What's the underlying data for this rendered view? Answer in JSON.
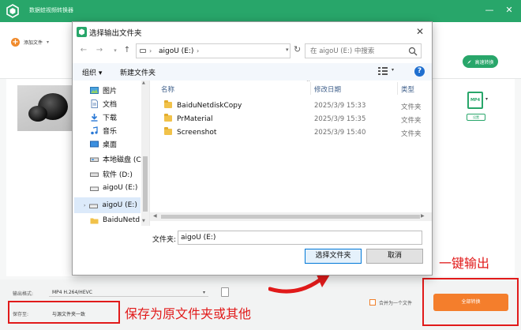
{
  "app": {
    "title": "数据蛙视频转换器",
    "add_file": "添加文件",
    "add_file_caret": "▾",
    "hw_accel": "高速转换",
    "format_badge": "MP4",
    "settings_label": "设置",
    "window_minimize": "—",
    "window_close": "✕"
  },
  "footer": {
    "output_format_label": "输出格式:",
    "output_format_value": "MP4 H.264/HEVC",
    "save_to_label": "保存至:",
    "save_to_value": "与源文件夹一致",
    "merge_label": "合并为一个文件",
    "convert_all": "全部转换"
  },
  "annotations": {
    "save_text": "保存为原文件夹或其他",
    "export_text": "一键输出",
    "color": "#e11a1a"
  },
  "dialog": {
    "title": "选择输出文件夹",
    "close": "✕",
    "address": "aigoU (E:)",
    "address_sep": "›",
    "search_placeholder": "在 aigoU (E:) 中搜索",
    "organize": "组织 ▾",
    "new_folder": "新建文件夹",
    "help": "?",
    "nav_items": [
      {
        "label": "图片",
        "icon": "pictures-icon"
      },
      {
        "label": "文档",
        "icon": "documents-icon"
      },
      {
        "label": "下载",
        "icon": "download-icon"
      },
      {
        "label": "音乐",
        "icon": "music-icon"
      },
      {
        "label": "桌面",
        "icon": "desktop-icon"
      },
      {
        "label": "本地磁盘 (C:)",
        "icon": "drive-icon"
      },
      {
        "label": "软件 (D:)",
        "icon": "drive-icon"
      },
      {
        "label": "aigoU (E:)",
        "icon": "usb-drive-icon"
      },
      {
        "label": "aigoU (E:)",
        "icon": "usb-drive-icon"
      },
      {
        "label": "BaiduNetd",
        "icon": "folder-icon"
      }
    ],
    "columns": {
      "name": "名称",
      "date": "修改日期",
      "type": "类型"
    },
    "files": [
      {
        "name": "BaiduNetdiskCopy",
        "date": "2025/3/9 15:33",
        "type": "文件夹"
      },
      {
        "name": "PrMaterial",
        "date": "2025/3/9 15:35",
        "type": "文件夹"
      },
      {
        "name": "Screenshot",
        "date": "2025/3/9 15:40",
        "type": "文件夹"
      }
    ],
    "folder_label": "文件夹:",
    "folder_value": "aigoU (E:)",
    "select_button": "选择文件夹",
    "cancel_button": "取消"
  },
  "colors": {
    "app_green": "#28a66a",
    "convert_orange": "#f47e2c",
    "selection_blue": "#dceafa"
  }
}
